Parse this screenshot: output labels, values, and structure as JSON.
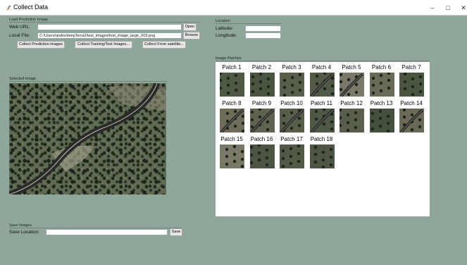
{
  "window": {
    "title": "Collect Data",
    "controls": {
      "minimize": "–",
      "maximize": "□",
      "close": "✕"
    }
  },
  "load": {
    "section_title": "Load Prediction Image",
    "web_url_label": "Web URL:",
    "web_url_value": "",
    "open_button": "Open",
    "local_file_label": "Local File:",
    "local_file_value": "C:/Users/andre/deepTerra2/test_images/test_image_large_003.png",
    "browse_button": "Browse",
    "collect_prediction_button": "Collect Prediction images",
    "collect_training_button": "Collect Training/Test Images...",
    "collect_satellite_button": "Collect From satellite..."
  },
  "location": {
    "section_title": "Location",
    "latitude_label": "Latitude:",
    "latitude_value": "",
    "longitude_label": "Longitude:",
    "longitude_value": ""
  },
  "selected_image": {
    "section_title": "Selected Image"
  },
  "patches": {
    "section_title": "Image Patches",
    "items": [
      {
        "label": "Patch 1"
      },
      {
        "label": "Patch 2"
      },
      {
        "label": "Patch 3"
      },
      {
        "label": "Patch 4"
      },
      {
        "label": "Patch 5"
      },
      {
        "label": "Patch 6"
      },
      {
        "label": "Patch 7"
      },
      {
        "label": "Patch 8"
      },
      {
        "label": "Patch 9"
      },
      {
        "label": "Patch 10"
      },
      {
        "label": "Patch 11"
      },
      {
        "label": "Patch 12"
      },
      {
        "label": "Patch 13"
      },
      {
        "label": "Patch 14"
      },
      {
        "label": "Patch 15"
      },
      {
        "label": "Patch 16"
      },
      {
        "label": "Patch 17"
      },
      {
        "label": "Patch 18"
      }
    ]
  },
  "save": {
    "section_title": "Save Images",
    "location_label": "Save Location:",
    "location_value": "",
    "save_button": "Save"
  }
}
